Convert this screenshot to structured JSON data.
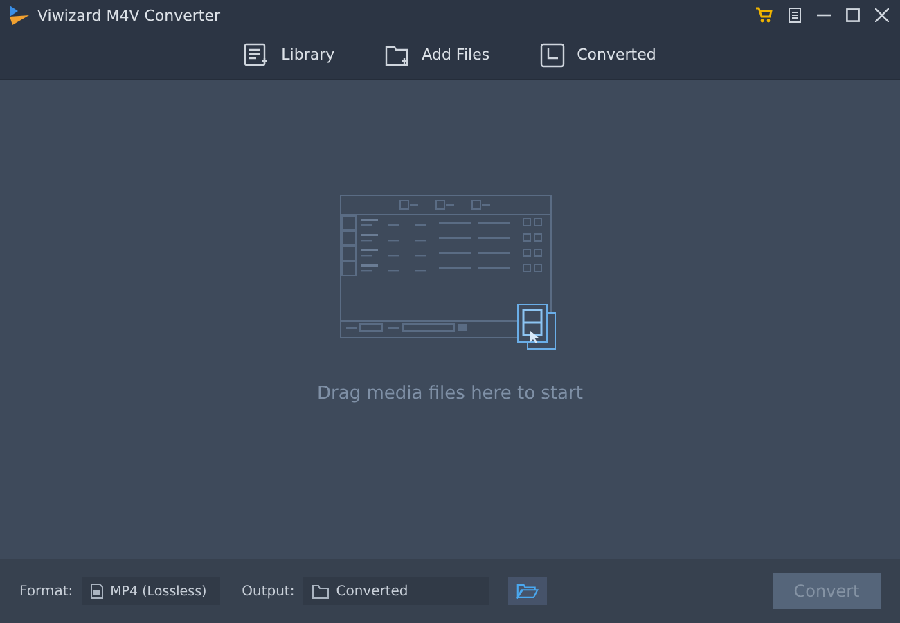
{
  "window": {
    "title": "Viwizard M4V Converter"
  },
  "toolbar": [
    {
      "label": "Library",
      "kind": "library"
    },
    {
      "label": "Add Files",
      "kind": "add"
    },
    {
      "label": "Converted",
      "kind": "converted"
    }
  ],
  "drop_area": {
    "hint": "Drag media files here to start"
  },
  "bottom_bar": {
    "format_label": "Format:",
    "format_value": "MP4 (Lossless)",
    "output_label": "Output:",
    "output_value": "Converted",
    "convert_button": {
      "label": "Convert",
      "disabled": true
    }
  }
}
